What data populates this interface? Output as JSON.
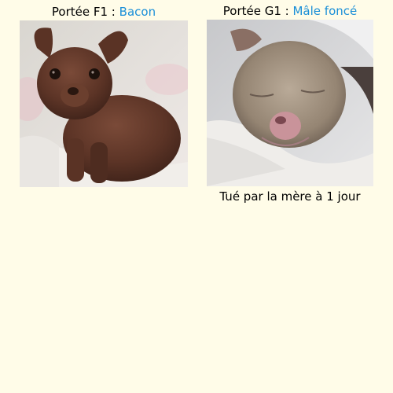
{
  "colors": {
    "background": "#fffce8",
    "name_link": "#1a8fd8",
    "text": "#000000"
  },
  "litters": [
    {
      "label": "Portée F1 :",
      "name": "Bacon",
      "photo_subject": "brown-puppy-photo",
      "note": ""
    },
    {
      "label": "Portée G1 :",
      "name": "Mâle foncé",
      "photo_subject": "sleeping-newborn-puppy-photo",
      "note": "Tué par la mère à 1 jour"
    }
  ]
}
